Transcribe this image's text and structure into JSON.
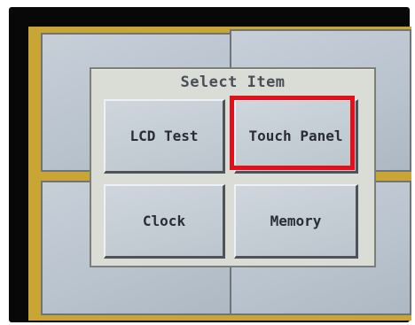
{
  "dialog": {
    "title": "Select Item",
    "items": [
      {
        "label": "LCD Test"
      },
      {
        "label": "Touch Panel"
      },
      {
        "label": "Clock"
      },
      {
        "label": "Memory"
      }
    ]
  },
  "highlight": {
    "target": "Touch Panel",
    "color": "#e3101a"
  },
  "colors": {
    "bezel": "#080808",
    "screen_frame": "#c9a536",
    "button_face": "#c6ced6",
    "dialog_bg": "#d9ddd6"
  }
}
